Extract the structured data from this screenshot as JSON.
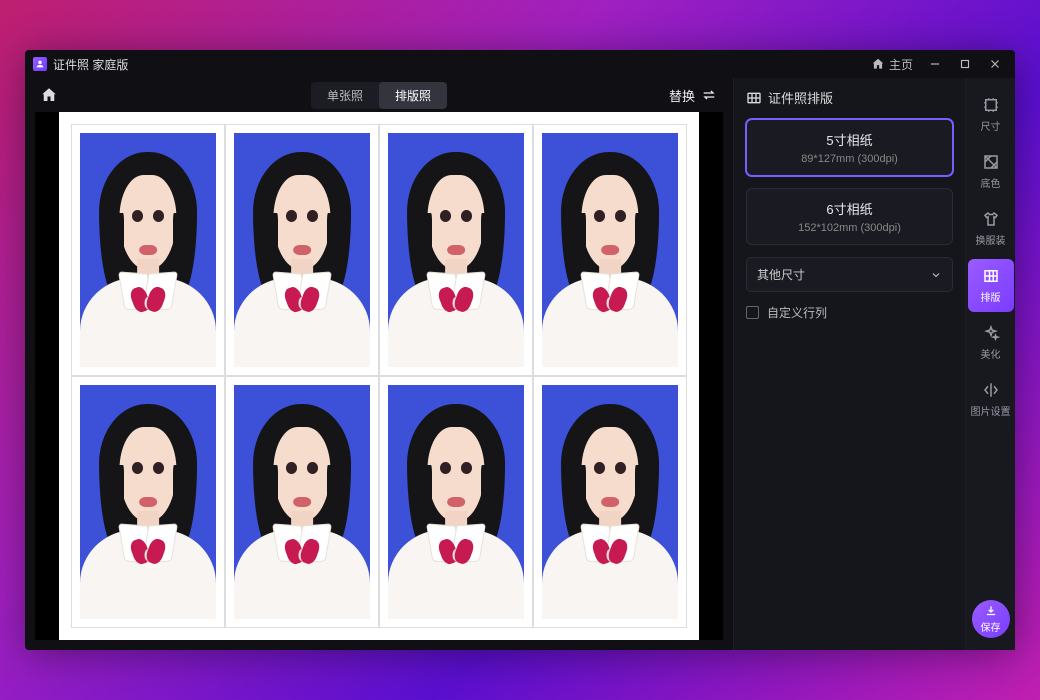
{
  "titlebar": {
    "app_title": "证件照 家庭版",
    "home_label": "主页"
  },
  "toolbar": {
    "tabs": {
      "single": "单张照",
      "layout": "排版照"
    },
    "replace_label": "替换"
  },
  "sidepanel": {
    "header": "证件照排版",
    "cards": [
      {
        "title": "5寸相纸",
        "subtitle": "89*127mm (300dpi)"
      },
      {
        "title": "6寸相纸",
        "subtitle": "152*102mm (300dpi)"
      }
    ],
    "other_sizes": "其他尺寸",
    "custom_rows_cols": "自定义行列"
  },
  "rail": {
    "items": [
      {
        "key": "size",
        "label": "尺寸"
      },
      {
        "key": "bgcolor",
        "label": "底色"
      },
      {
        "key": "clothing",
        "label": "换服装"
      },
      {
        "key": "layout",
        "label": "排版"
      },
      {
        "key": "beautify",
        "label": "美化"
      },
      {
        "key": "imgset",
        "label": "图片设置"
      }
    ],
    "save_label": "保存"
  },
  "photo_grid": {
    "rows": 2,
    "cols": 4
  }
}
